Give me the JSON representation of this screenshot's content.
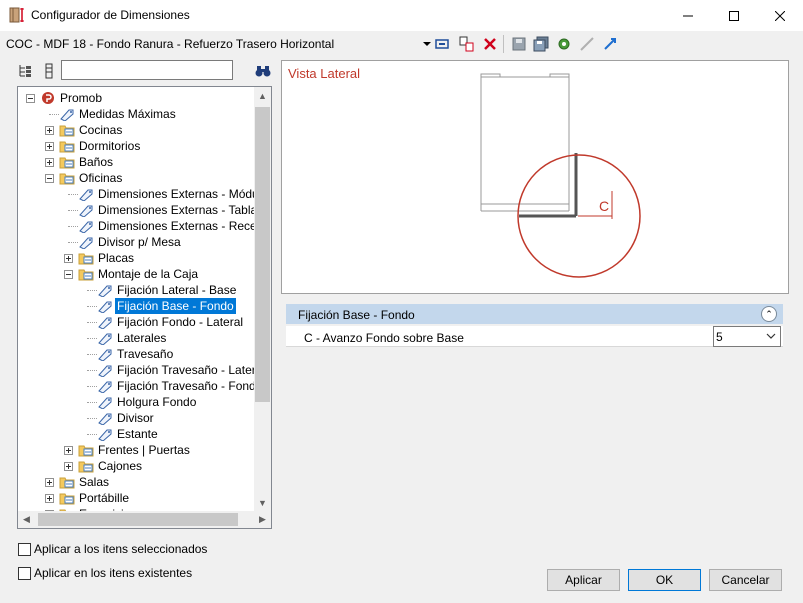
{
  "window": {
    "title": "Configurador de Dimensiones",
    "icon": "ruler-cabinet-icon"
  },
  "toolbar": {
    "config_path": "COC - MDF 18 - Fondo Ranura - Refuerzo Trasero Horizontal",
    "icons": [
      "dropdown-arrow-icon",
      "edit-icon",
      "copy-icon",
      "delete-icon",
      "save-icon",
      "save-all-icon",
      "settings-icon",
      "link-icon",
      "arrow-icon"
    ]
  },
  "left_panel": {
    "search_value": "",
    "tree": [
      {
        "label": "Promob",
        "level": 0,
        "type": "root",
        "expander": "minus"
      },
      {
        "label": "Medidas Máximas",
        "level": 1,
        "type": "tag"
      },
      {
        "label": "Cocinas",
        "level": 1,
        "type": "folder",
        "expander": "plus"
      },
      {
        "label": "Dormitorios",
        "level": 1,
        "type": "folder",
        "expander": "plus"
      },
      {
        "label": "Baños",
        "level": 1,
        "type": "folder",
        "expander": "plus"
      },
      {
        "label": "Oficinas",
        "level": 1,
        "type": "folder",
        "expander": "minus"
      },
      {
        "label": "Dimensiones Externas - Módulos",
        "level": 2,
        "type": "tag"
      },
      {
        "label": "Dimensiones Externas - Tablas",
        "level": 2,
        "type": "tag"
      },
      {
        "label": "Dimensiones Externas - Recepción",
        "level": 2,
        "type": "tag"
      },
      {
        "label": "Divisor p/ Mesa",
        "level": 2,
        "type": "tag"
      },
      {
        "label": "Placas",
        "level": 2,
        "type": "folder",
        "expander": "plus"
      },
      {
        "label": "Montaje de la Caja",
        "level": 2,
        "type": "folder",
        "expander": "minus"
      },
      {
        "label": "Fijación Lateral - Base",
        "level": 3,
        "type": "tag"
      },
      {
        "label": "Fijación Base - Fondo",
        "level": 3,
        "type": "tag",
        "selected": true
      },
      {
        "label": "Fijación Fondo - Lateral",
        "level": 3,
        "type": "tag"
      },
      {
        "label": "Laterales",
        "level": 3,
        "type": "tag"
      },
      {
        "label": "Travesaño",
        "level": 3,
        "type": "tag"
      },
      {
        "label": "Fijación Travesaño - Lateral",
        "level": 3,
        "type": "tag"
      },
      {
        "label": "Fijación Travesaño - Fondo",
        "level": 3,
        "type": "tag"
      },
      {
        "label": "Holgura Fondo",
        "level": 3,
        "type": "tag"
      },
      {
        "label": "Divisor",
        "level": 3,
        "type": "tag"
      },
      {
        "label": "Estante",
        "level": 3,
        "type": "tag"
      },
      {
        "label": "Frentes | Puertas",
        "level": 2,
        "type": "folder",
        "expander": "plus"
      },
      {
        "label": "Cajones",
        "level": 2,
        "type": "folder",
        "expander": "plus"
      },
      {
        "label": "Salas",
        "level": 1,
        "type": "folder",
        "expander": "plus"
      },
      {
        "label": "Portábille",
        "level": 1,
        "type": "folder",
        "expander": "plus"
      },
      {
        "label": "Exposiciones",
        "level": 1,
        "type": "folder",
        "expander": "plus"
      }
    ]
  },
  "preview": {
    "title": "Vista Lateral",
    "dimension_label": "C"
  },
  "properties": {
    "group": "Fijación Base - Fondo",
    "rows": [
      {
        "name": "C - Avanzo Fondo sobre Base",
        "value": "5"
      }
    ]
  },
  "checkboxes": [
    {
      "label": "Aplicar a los itens seleccionados",
      "checked": false
    },
    {
      "label": "Aplicar en los itens existentes",
      "checked": false
    }
  ],
  "buttons": {
    "apply": "Aplicar",
    "ok": "OK",
    "cancel": "Cancelar"
  },
  "colors": {
    "accent": "#0078d7",
    "preview_red": "#c0392b",
    "group_header": "#c3d7ec"
  }
}
